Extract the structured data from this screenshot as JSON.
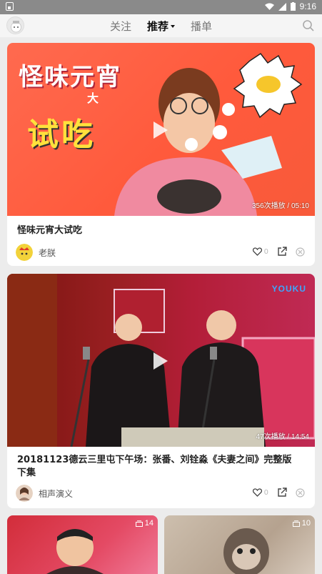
{
  "status_bar": {
    "time": "9:16"
  },
  "nav": {
    "tabs": [
      {
        "label": "关注"
      },
      {
        "label": "推荐"
      },
      {
        "label": "播单"
      }
    ]
  },
  "feed": [
    {
      "thumbnail_text": {
        "main": "怪味元宵",
        "small": "大",
        "sub": "试吃"
      },
      "play_meta": "356次播放 / 05:10",
      "title": "怪味元宵大试吃",
      "author": "老朕",
      "like_count": "0"
    },
    {
      "thumbnail_text": {
        "logo": "YOUKU"
      },
      "play_meta": "47次播放 / 14:54",
      "title": "20181123德云三里屯下午场：张番、刘铨淼《夫妻之间》完整版下集",
      "author": "相声演义",
      "like_count": "0"
    }
  ],
  "grid": [
    {
      "count": "14"
    },
    {
      "count": "10"
    }
  ],
  "colors": {
    "accent_red": "#ff5a3c",
    "text": "#222222",
    "muted": "#bbbbbb"
  }
}
